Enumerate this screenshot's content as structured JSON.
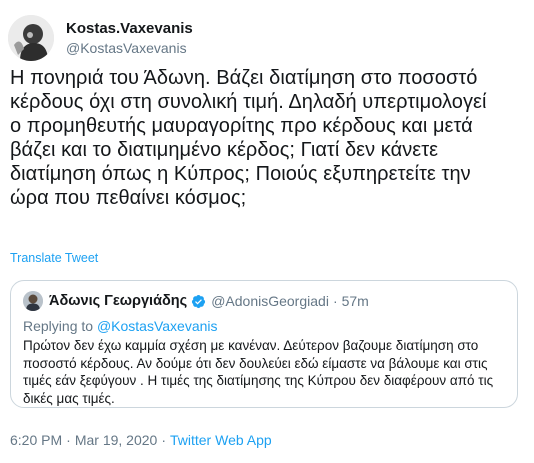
{
  "author": {
    "display_name": "Kostas.Vaxevanis",
    "handle": "@KostasVaxevanis",
    "avatar_icon": "avatar-icon"
  },
  "tweet": {
    "text": "Η πονηριά του Άδωνη. Βάζει διατίμηση στο ποσοστό\nκέρδους όχι στη συνολική τιμή. Δηλαδή υπερτιμολογεί\nο προμηθευτής μαυραγορίτης προ κέρδους και μετά\nβάζει και το διατιμημένο κέρδος; Γιατί δεν κάνετε\nδιατίμηση όπως η Κύπρος; Ποιούς εξυπηρετείτε την\nώρα που πεθαίνει κόσμος;",
    "translate_label": "Translate Tweet"
  },
  "quote": {
    "display_name": "Άδωνις Γεωργιάδης",
    "verified_icon": "verified-badge-icon",
    "handle": "@AdonisGeorgiadi",
    "separator": "·",
    "time": "57m",
    "replying_prefix": "Replying to ",
    "replying_to": "@KostasVaxevanis",
    "text": "Πρώτον δεν έχω καμμία σχέση με κανέναν. Δεύτερον βαζουμε διατίμηση στο ποσοστό κέρδους. Αν δούμε ότι δεν δουλεύει εδώ είμαστε να βάλουμε και στις τιμές εάν ξεφύγουν . Η τιμές της διατίμησης της Κύπρου δεν διαφέρουν από τις δικές μας τιμές."
  },
  "footer": {
    "time": "6:20 PM",
    "separator": "·",
    "date": "Mar 19, 2020",
    "source": "Twitter Web App"
  },
  "colors": {
    "link": "#1da1f2",
    "secondary_text": "#657786",
    "border": "#ccd6dd"
  }
}
